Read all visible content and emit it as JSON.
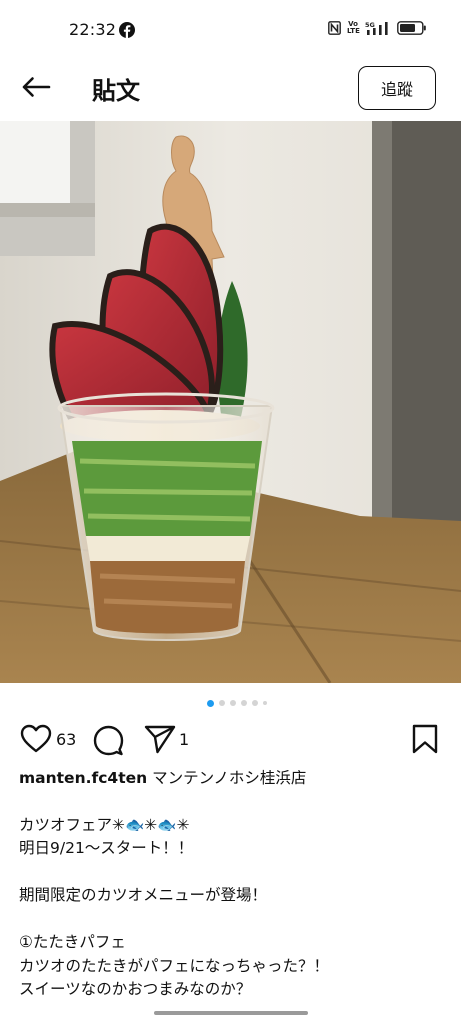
{
  "status_bar": {
    "time": "22:32",
    "app_notification_icon": "facebook-icon",
    "system_icons": [
      "nfc-icon",
      "volte-icon",
      "5g-signal-icon",
      "battery-icon"
    ],
    "volte_label_top": "Vo",
    "volte_label_bottom": "LTE",
    "network_label": "5G"
  },
  "header": {
    "back_icon": "arrow-left-icon",
    "title": "貼文",
    "follow_label": "追蹤"
  },
  "post": {
    "image_description_icon": "photo",
    "carousel": {
      "total": 6,
      "active_index": 0
    },
    "actions": {
      "like_icon": "heart-icon",
      "like_count": "63",
      "comment_icon": "comment-icon",
      "share_icon": "send-icon",
      "share_count": "1",
      "save_icon": "bookmark-icon"
    },
    "author": {
      "handle": "manten.fc4ten",
      "display_name": "マンテンノホシ桂浜店"
    },
    "caption_lines": [
      "カツオフェア✳︎🐟✳︎🐟✳︎",
      "明日9/21〜スタート！！",
      "",
      "期間限定のカツオメニューが登場！",
      "",
      "①たたきパフェ",
      "カツオのたたきがパフェになっちゃった？！",
      "スイーツなのかおつまみなのか？"
    ]
  },
  "colors": {
    "accent_dot": "#1d9bf0",
    "text": "#111111",
    "background": "#ffffff"
  }
}
